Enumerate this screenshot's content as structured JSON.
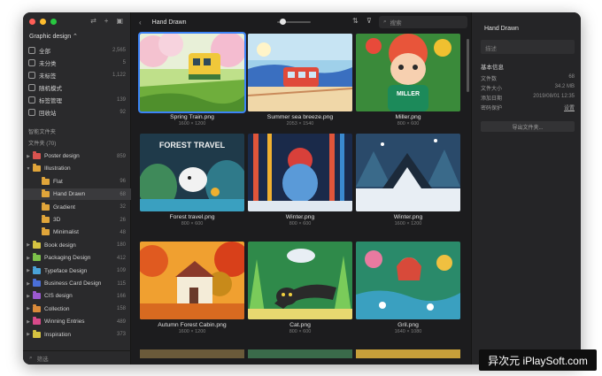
{
  "sidebar": {
    "tools": [
      "⇄",
      "+",
      "▣"
    ],
    "library": "Graphic design ⌃",
    "top_items": [
      {
        "label": "全部",
        "count": "2,565",
        "icon": "all-items-icon"
      },
      {
        "label": "未分类",
        "count": "5",
        "icon": "unsorted-icon"
      },
      {
        "label": "未标签",
        "count": "1,122",
        "icon": "untagged-icon"
      },
      {
        "label": "随机模式",
        "count": "",
        "icon": "random-icon"
      },
      {
        "label": "标签管理",
        "count": "139",
        "icon": "tag-manager-icon"
      },
      {
        "label": "回收站",
        "count": "92",
        "icon": "trash-icon"
      }
    ],
    "smart_folders_title": "智能文件夹",
    "folders_title": "文件夹 (70)",
    "folders": [
      {
        "label": "Poster design",
        "count": "859",
        "color": "#d9534f",
        "level": 0,
        "arrow": "▶"
      },
      {
        "label": "Illustration",
        "count": "",
        "color": "#e0a53a",
        "level": 0,
        "arrow": "▼"
      },
      {
        "label": "Flat",
        "count": "96",
        "color": "#e0a53a",
        "level": 1,
        "arrow": ""
      },
      {
        "label": "Hand Drawn",
        "count": "68",
        "color": "#e0a53a",
        "level": 1,
        "arrow": "",
        "active": true
      },
      {
        "label": "Gradient",
        "count": "32",
        "color": "#e0a53a",
        "level": 1,
        "arrow": ""
      },
      {
        "label": "3D",
        "count": "26",
        "color": "#e0a53a",
        "level": 1,
        "arrow": ""
      },
      {
        "label": "Minimalist",
        "count": "48",
        "color": "#e0a53a",
        "level": 1,
        "arrow": ""
      },
      {
        "label": "Book design",
        "count": "180",
        "color": "#d6c341",
        "level": 0,
        "arrow": "▶"
      },
      {
        "label": "Packaging Design",
        "count": "412",
        "color": "#7cc04a",
        "level": 0,
        "arrow": "▶"
      },
      {
        "label": "Typeface Design",
        "count": "109",
        "color": "#4aa3d8",
        "level": 0,
        "arrow": "▶"
      },
      {
        "label": "Business Card Design",
        "count": "115",
        "color": "#4a6fd8",
        "level": 0,
        "arrow": "▶"
      },
      {
        "label": "CIS design",
        "count": "166",
        "color": "#9b59d0",
        "level": 0,
        "arrow": "▶"
      },
      {
        "label": "Collection",
        "count": "158",
        "color": "#d98a3a",
        "level": 0,
        "arrow": "▶"
      },
      {
        "label": "Winning Entries",
        "count": "489",
        "color": "#d84a8a",
        "level": 0,
        "arrow": "▶"
      },
      {
        "label": "Inspiration",
        "count": "373",
        "color": "#d6c341",
        "level": 0,
        "arrow": "▶"
      }
    ],
    "filter_placeholder": "筛选"
  },
  "toolbar": {
    "back": "‹",
    "title": "Hand Drawn",
    "sort": "⇅",
    "filter": "⊽",
    "search_placeholder": "搜索"
  },
  "items": [
    {
      "name": "Spring Train.png",
      "dims": "1600 × 1200",
      "selected": true
    },
    {
      "name": "Summer sea breeze.png",
      "dims": "2053 × 1540"
    },
    {
      "name": "Miller.png",
      "dims": "800 × 600"
    },
    {
      "name": "Forest travel.png",
      "dims": "800 × 600"
    },
    {
      "name": "Winter.png",
      "dims": "800 × 600"
    },
    {
      "name": "Winter.png",
      "dims": "1600 × 1200"
    },
    {
      "name": "Autumn Forest Cabin.png",
      "dims": "1600 × 1200"
    },
    {
      "name": "Cat.png",
      "dims": "800 × 600"
    },
    {
      "name": "Gril.png",
      "dims": "1640 × 1080"
    }
  ],
  "thumb_text": {
    "forest_travel": "FOREST TRAVEL",
    "miller": "MILLER"
  },
  "panel": {
    "title": "Hand Drawn",
    "note_placeholder": "描述",
    "section": "基本信息",
    "rows": [
      {
        "label": "文件数",
        "value": "68"
      },
      {
        "label": "文件大小",
        "value": "34.2 MB"
      },
      {
        "label": "添加日期",
        "value": "2019/08/01 12:35"
      },
      {
        "label": "密码保护",
        "value": "设置"
      }
    ],
    "export_button": "导出文件夹..."
  },
  "watermark": "异次元 iPlaySoft.com"
}
